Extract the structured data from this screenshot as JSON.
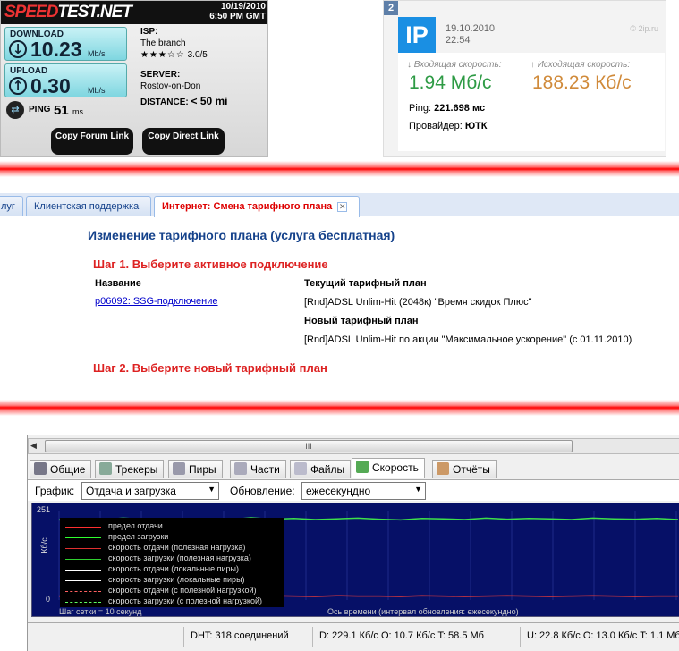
{
  "speedtest": {
    "logo_a": "SPEED",
    "logo_b": "TEST.NET",
    "date": "10/19/2010",
    "time": "6:50 PM GMT",
    "download_label": "DOWNLOAD",
    "download_value": "10.23",
    "download_unit": "Mb/s",
    "upload_label": "UPLOAD",
    "upload_value": "0.30",
    "upload_unit": "Mb/s",
    "ping_label": "PING",
    "ping_value": "51",
    "ping_unit": "ms",
    "isp_label": "ISP:",
    "isp_value": "The branch",
    "rating": "3.0/5",
    "rating_stars": 3,
    "server_label": "SERVER:",
    "server_value": "Rostov-on-Don",
    "distance_label": "DISTANCE:",
    "distance_value": "< 50 mi",
    "btn_forum": "Copy Forum Link",
    "btn_direct": "Copy Direct Link"
  },
  "twoip": {
    "badge": "2",
    "logo": "IP",
    "date": "19.10.2010",
    "time": "22:54",
    "site": "© 2ip.ru",
    "in_label": "↓ Входящая скорость:",
    "in_value": "1.94 Мб/с",
    "out_label": "↑ Исходящая скорость:",
    "out_value": "188.23 Кб/с",
    "ping_label": "Ping:",
    "ping_value": "221.698 мс",
    "provider_label": "Провайдер:",
    "provider_value": "ЮТК",
    "colors": {
      "in": "#2e9b45",
      "out": "#d08a3a",
      "logo": "#1a8fe3"
    }
  },
  "tariff_tabs": [
    {
      "label": "луг"
    },
    {
      "label": "Клиентская поддержка"
    },
    {
      "label": "Интернет: Смена тарифного плана",
      "active": true
    }
  ],
  "tariff": {
    "title": "Изменение тарифного плана (услуга бесплатная)",
    "step1": "Шаг 1. Выберите активное подключение",
    "name_header": "Название",
    "connection": "p06092: SSG-подключение",
    "current_header": "Текущий тарифный план",
    "current_value": "[Rnd]ADSL Unlim-Hit (2048к) \"Время скидок Плюс\"",
    "new_header": "Новый тарифный план",
    "new_value": "[Rnd]ADSL Unlim-Hit по акции \"Максимальное ускорение\" (с 01.11.2010)",
    "step2": "Шаг 2. Выберите новый тарифный план"
  },
  "client": {
    "scroll_thumb": "III",
    "tabs": [
      {
        "label": "Общие",
        "icon": "info-icon"
      },
      {
        "label": "Трекеры",
        "icon": "trackers-icon"
      },
      {
        "label": "Пиры",
        "icon": "peers-icon"
      },
      {
        "label": "Части",
        "icon": "pieces-icon"
      },
      {
        "label": "Файлы",
        "icon": "files-icon"
      },
      {
        "label": "Скорость",
        "icon": "speed-graph-icon",
        "active": true
      },
      {
        "label": "Отчёты",
        "icon": "logger-icon"
      }
    ],
    "graph_label": "График:",
    "graph_select": "Отдача и загрузка",
    "update_label": "Обновление:",
    "update_select": "ежесекундно",
    "y_unit": "Кб/с",
    "y_max": "251",
    "y_min": "0",
    "legend": [
      {
        "label": "предел отдачи",
        "color": "#ff3030",
        "style": "solid"
      },
      {
        "label": "предел загрузки",
        "color": "#30ff30",
        "style": "solid"
      },
      {
        "label": "скорость отдачи (полезная нагрузка)",
        "color": "#e03030",
        "style": "solid"
      },
      {
        "label": "скорость загрузки (полезная нагрузка)",
        "color": "#30d030",
        "style": "solid"
      },
      {
        "label": "скорость отдачи (локальные пиры)",
        "color": "#ffffff",
        "style": "solid"
      },
      {
        "label": "скорость загрузки (локальные пиры)",
        "color": "#ffffff",
        "style": "solid"
      },
      {
        "label": "скорость отдачи (с полезной нагрузкой)",
        "color": "#ff6060",
        "style": "dashed"
      },
      {
        "label": "скорость загрузки (с полезной нагрузкой)",
        "color": "#60ff60",
        "style": "dashed"
      }
    ],
    "grid_step": "Шаг сетки = 10 секунд",
    "time_axis": "Ось времени (интервал обновления: ежесекундно)",
    "status_dht": "DHT: 318 соединений",
    "status_down": "D: 229.1 Кб/с O: 10.7 Кб/с T: 58.5 Мб",
    "status_up": "U: 22.8 Кб/с O: 13.0 Кб/с T: 1.1 Мб"
  },
  "chart_data": {
    "type": "line",
    "ylabel": "Кб/с",
    "ylim": [
      0,
      251
    ],
    "grid": true,
    "series": [
      {
        "name": "скорость загрузки (полезная нагрузка)",
        "values": [
          225,
          228,
          226,
          230,
          227,
          229,
          224,
          228,
          226,
          231,
          227,
          229,
          226,
          228,
          230,
          227,
          225,
          229,
          228,
          226,
          230,
          227,
          229,
          228,
          226,
          230,
          228,
          227,
          229,
          226
        ]
      },
      {
        "name": "скорость отдачи (полезная нагрузка)",
        "values": [
          11,
          12,
          10,
          12,
          11,
          10,
          12,
          11,
          10,
          11,
          12,
          11,
          10,
          12,
          11,
          11,
          10,
          12,
          11,
          10,
          11,
          12,
          11,
          10,
          11,
          12,
          11,
          10,
          11,
          11
        ]
      }
    ]
  }
}
